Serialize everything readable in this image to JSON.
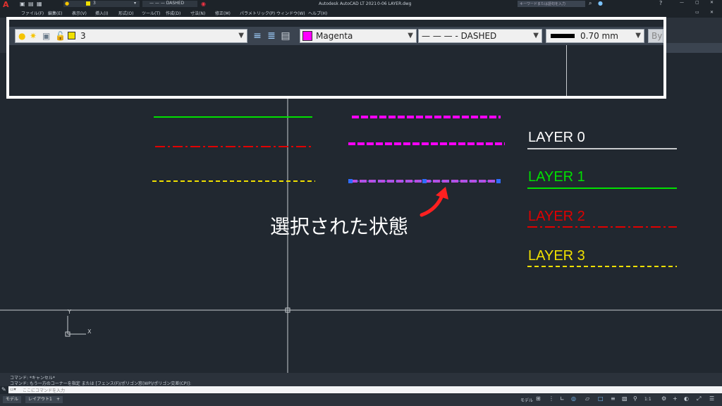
{
  "app": {
    "title": "Autodesk AutoCAD LT 2021",
    "filename": "0-06 LAYER.dwg",
    "search_placeholder": "キーワードまたは語句を入力"
  },
  "quick_access": {
    "layer_value": "3",
    "linetype_value": "— — —  DASHED"
  },
  "menu": [
    "ファイル(F)",
    "編集(E)",
    "表示(V)",
    "挿入(I)",
    "形式(O)",
    "ツール(T)",
    "作成(D)",
    "寸法(N)",
    "修正(M)",
    "パラメトリック(P)",
    "ウィンドウ(W)",
    "ヘルプ(H)"
  ],
  "toolbar": {
    "layer_value": "3",
    "color_value": "Magenta",
    "color_swatch": "#ff00ff",
    "linetype_value": "— — — - DASHED",
    "lineweight_value": "0.70 mm",
    "plotstyle_value": "By"
  },
  "canvas": {
    "layers": [
      {
        "label": "LAYER 0",
        "color": "#ffffff",
        "linestyle": "continuous"
      },
      {
        "label": "LAYER 1",
        "color": "#00e000",
        "linestyle": "continuous"
      },
      {
        "label": "LAYER 2",
        "color": "#e00000",
        "linestyle": "dashdot"
      },
      {
        "label": "LAYER 3",
        "color": "#f0e000",
        "linestyle": "dashed"
      }
    ],
    "caption": "選択された状態",
    "ucs_y": "Y",
    "ucs_x": "X"
  },
  "command_line": {
    "history": [
      "コマンド: *キャンセル*",
      "コマンド: もう一方のコーナーを指定 または [フェンス(F)/ポリゴン窓(WP)/ポリゴン交差(CP)]:"
    ],
    "input_placeholder": "ここにコマンドを入力"
  },
  "status": {
    "tabs": [
      "モデル",
      "レイアウト1"
    ],
    "add_tab": "+",
    "model_label": "モデル",
    "scale": "1:1"
  }
}
